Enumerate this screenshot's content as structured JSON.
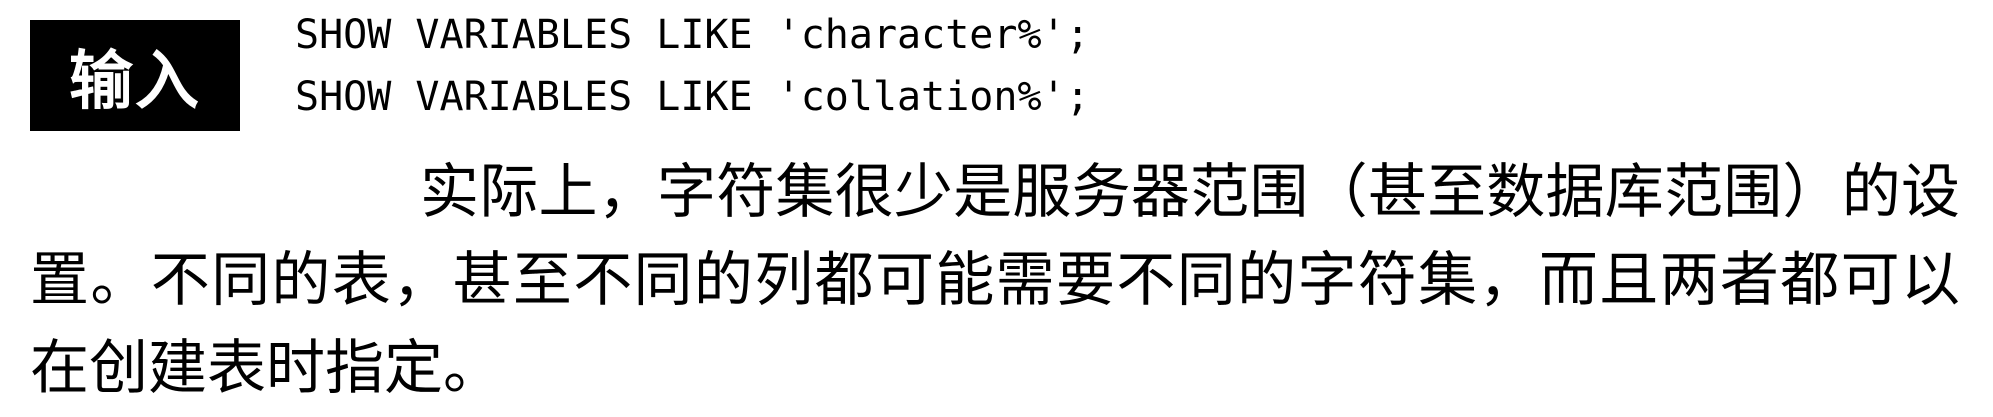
{
  "label": {
    "input": "输入"
  },
  "code": {
    "lines": [
      "SHOW VARIABLES LIKE 'character%';",
      "SHOW VARIABLES LIKE 'collation%';"
    ]
  },
  "body": {
    "paragraph": "实际上，字符集很少是服务器范围（甚至数据库范围）的设置。不同的表，甚至不同的列都可能需要不同的字符集，而且两者都可以在创建表时指定。"
  }
}
